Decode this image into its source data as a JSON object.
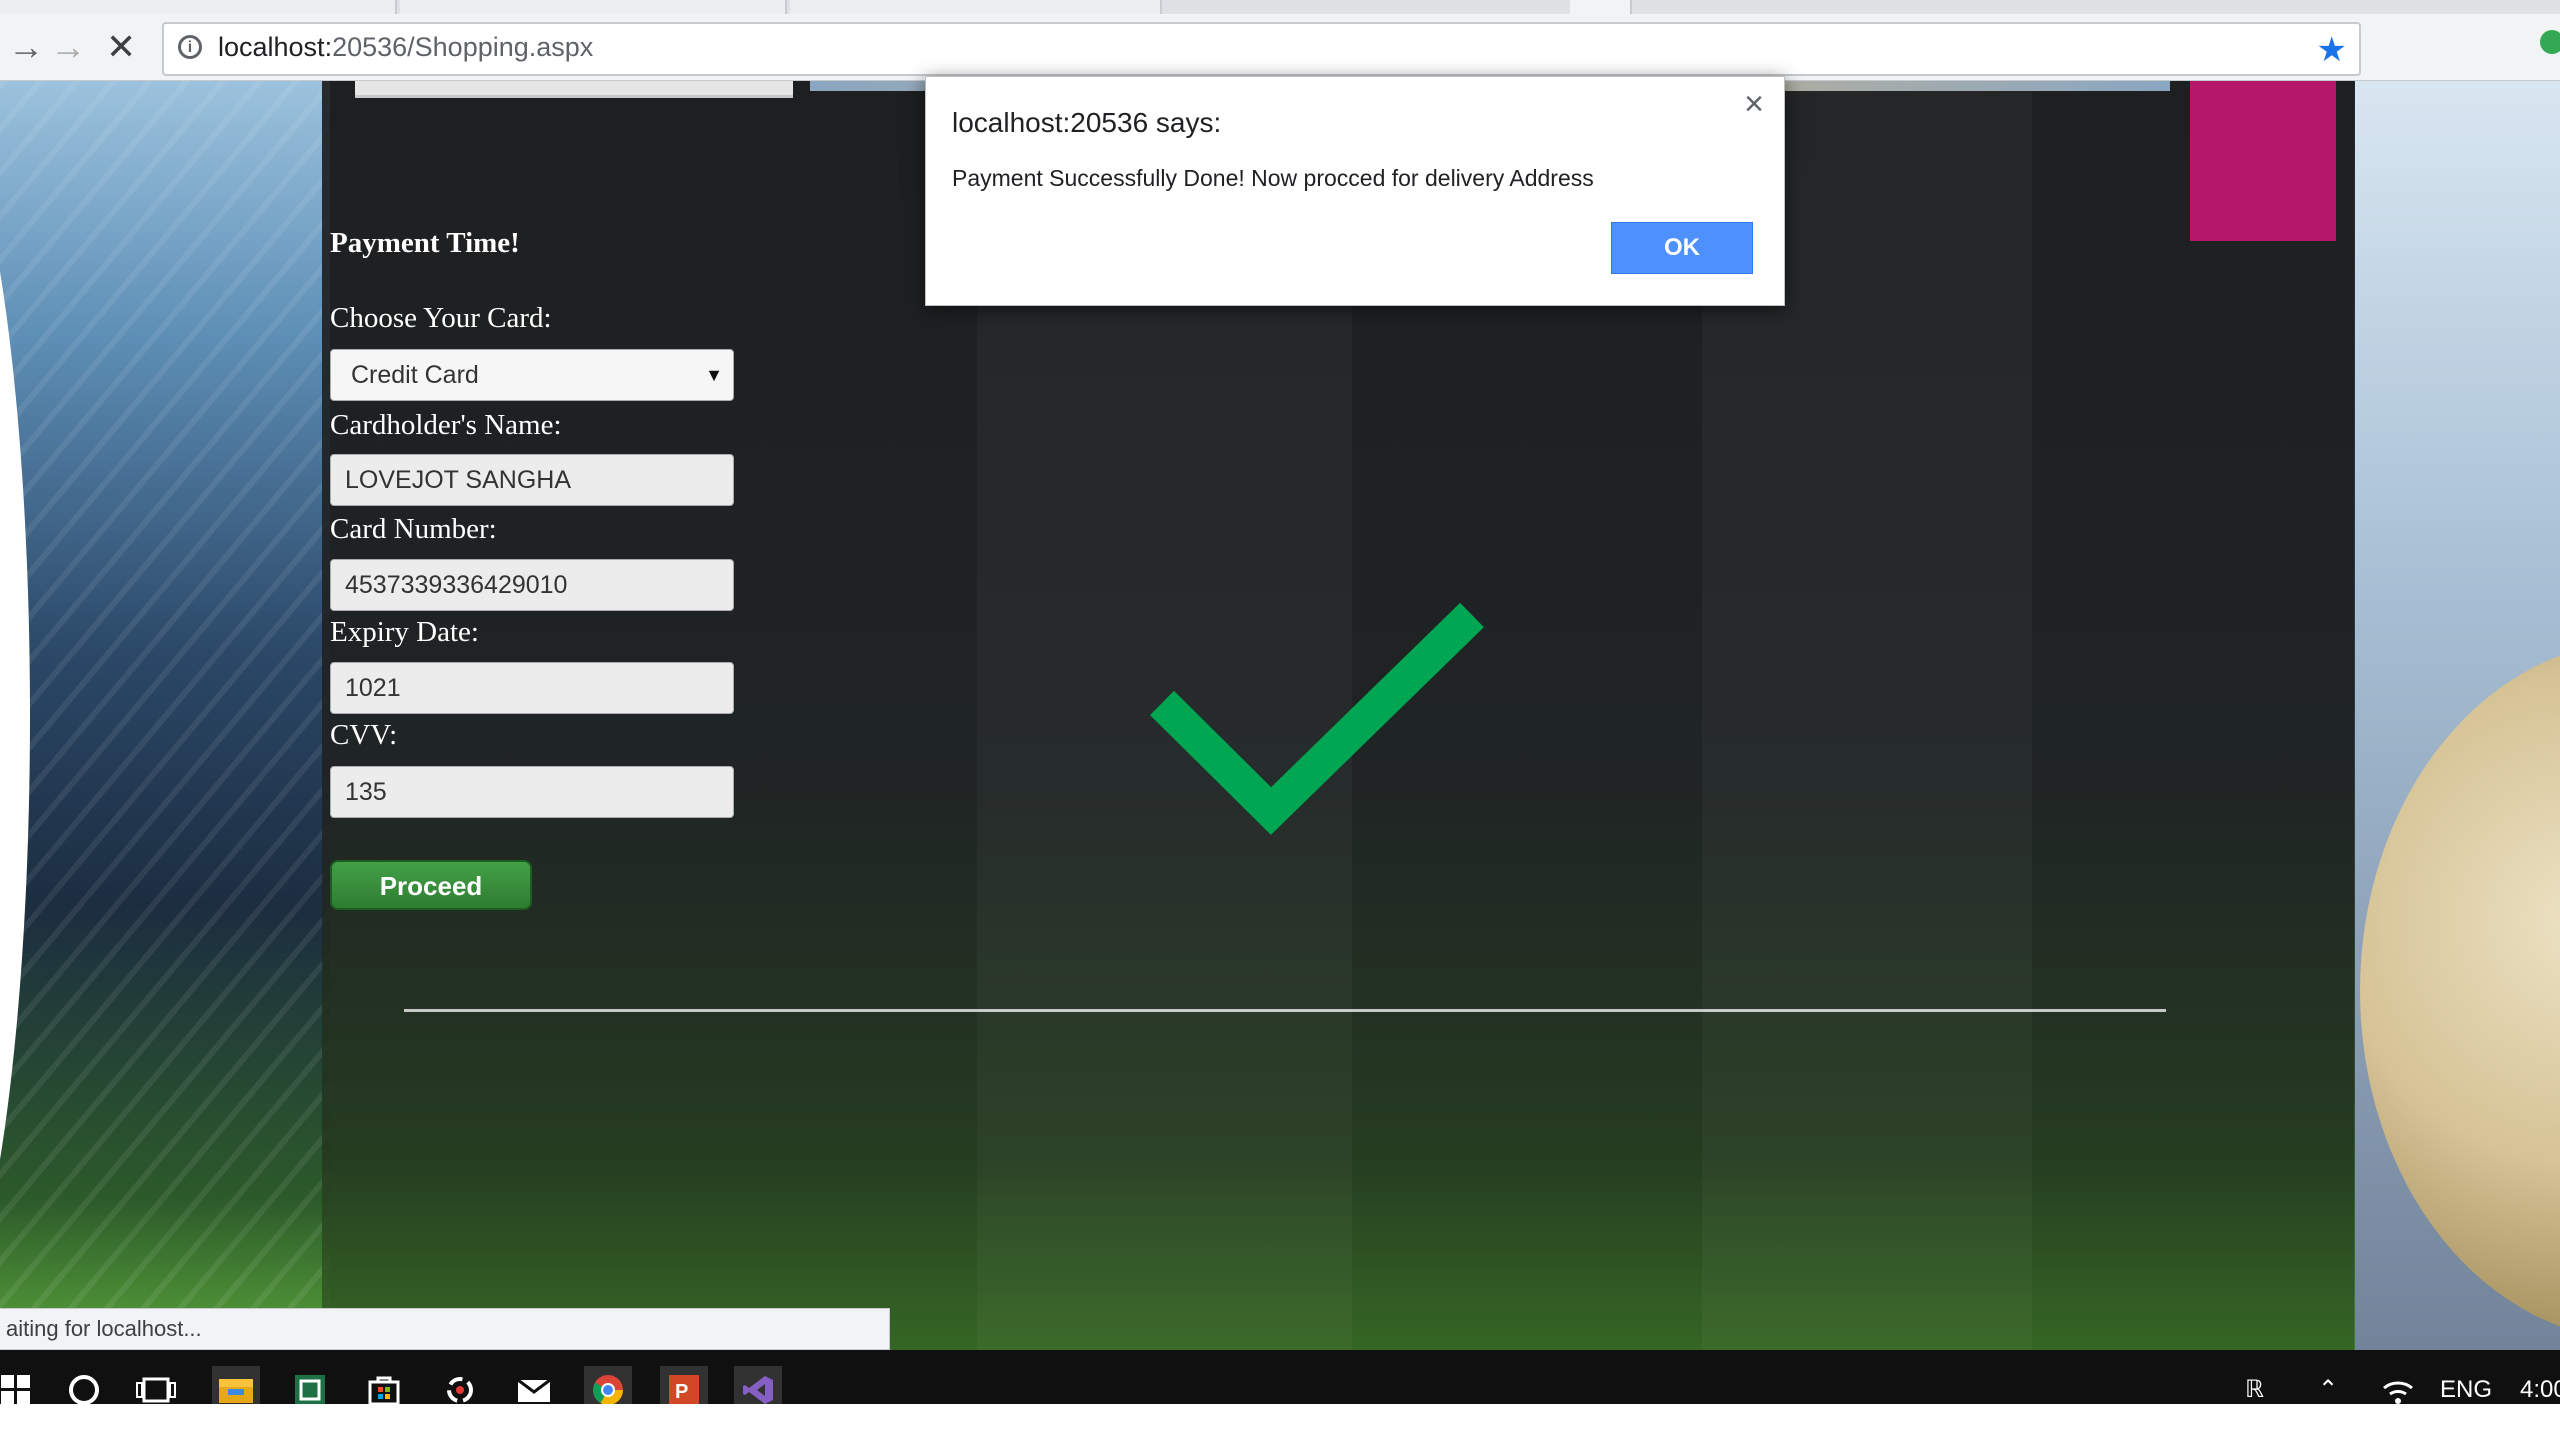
{
  "browser": {
    "url_host": "localhost:",
    "url_path": "20536/Shopping.aspx",
    "status_text": "aiting for localhost..."
  },
  "form": {
    "title": "Payment Time!",
    "card_label": "Choose Your Card:",
    "card_selected": "Credit Card",
    "name_label": "Cardholder's Name:",
    "name_value": "LOVEJOT SANGHA",
    "number_label": "Card Number:",
    "number_value": "4537339336429010",
    "expiry_label": "Expiry Date:",
    "expiry_value": "1021",
    "cvv_label": "CVV:",
    "cvv_value": "135",
    "proceed_label": "Proceed"
  },
  "dialog": {
    "title": "localhost:20536 says:",
    "message": "Payment Successfully Done! Now procced for delivery Address",
    "ok_label": "OK",
    "close_glyph": "×"
  },
  "taskbar": {
    "icons": [
      "windows-start-icon",
      "cortana-icon",
      "task-view-icon",
      "file-explorer-icon",
      "excel-icon",
      "store-icon",
      "app-icon",
      "mail-icon",
      "chrome-icon",
      "powerpoint-icon",
      "visual-studio-icon"
    ],
    "tray": {
      "language": "ENG",
      "time": "4:00"
    }
  },
  "colors": {
    "checkmark": "#00a651",
    "ok_button": "#4d90fe",
    "proceed_button": "#2e7d32",
    "accent_block": "#b5176b"
  }
}
